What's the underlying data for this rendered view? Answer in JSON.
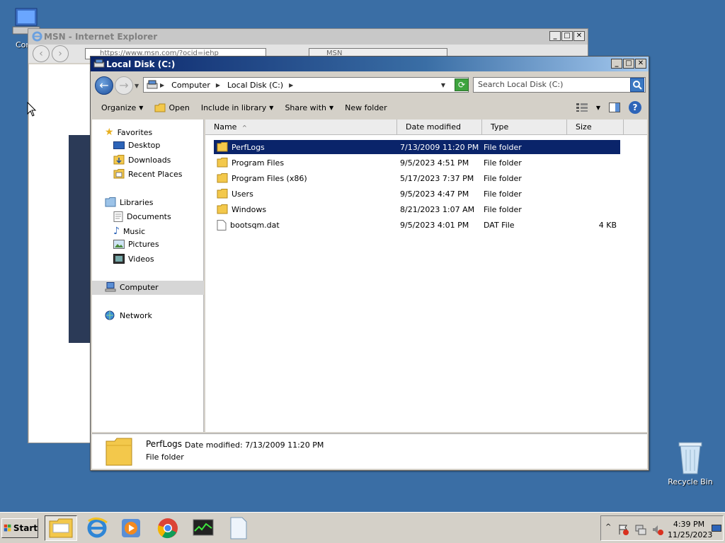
{
  "desktop": {
    "computer_icon_label": "Comp",
    "recycle_bin_label": "Recycle Bin"
  },
  "ie": {
    "title": "MSN - Internet Explorer",
    "address": "https://www.msn.com/?ocid=iehp",
    "tab_label": "MSN"
  },
  "explorer": {
    "title": "Local Disk (C:)",
    "breadcrumbs": [
      "Computer",
      "Local Disk (C:)"
    ],
    "search_placeholder": "Search Local Disk (C:)",
    "toolbar": {
      "organize": "Organize",
      "open": "Open",
      "include_in_library": "Include in library",
      "share_with": "Share with",
      "new_folder": "New folder"
    },
    "nav": {
      "favorites": "Favorites",
      "desktop": "Desktop",
      "downloads": "Downloads",
      "recent_places": "Recent Places",
      "libraries": "Libraries",
      "documents": "Documents",
      "music": "Music",
      "pictures": "Pictures",
      "videos": "Videos",
      "computer": "Computer",
      "network": "Network"
    },
    "columns": {
      "name": "Name",
      "date_modified": "Date modified",
      "type": "Type",
      "size": "Size"
    },
    "files": [
      {
        "name": "PerfLogs",
        "date": "7/13/2009 11:20 PM",
        "type": "File folder",
        "size": ""
      },
      {
        "name": "Program Files",
        "date": "9/5/2023 4:51 PM",
        "type": "File folder",
        "size": ""
      },
      {
        "name": "Program Files (x86)",
        "date": "5/17/2023 7:37 PM",
        "type": "File folder",
        "size": ""
      },
      {
        "name": "Users",
        "date": "9/5/2023 4:47 PM",
        "type": "File folder",
        "size": ""
      },
      {
        "name": "Windows",
        "date": "8/21/2023 1:07 AM",
        "type": "File folder",
        "size": ""
      },
      {
        "name": "bootsqm.dat",
        "date": "9/5/2023 4:01 PM",
        "type": "DAT File",
        "size": "4 KB"
      }
    ],
    "details": {
      "name": "PerfLogs",
      "date_label": "Date modified:",
      "date_value": "7/13/2009 11:20 PM",
      "type": "File folder"
    }
  },
  "taskbar": {
    "start_label": "Start",
    "time": "4:39 PM",
    "date": "11/25/2023"
  },
  "colors": {
    "desktop_bg": "#3a6ea5",
    "selection": "#0a246a",
    "title_active": "#0a246a"
  }
}
